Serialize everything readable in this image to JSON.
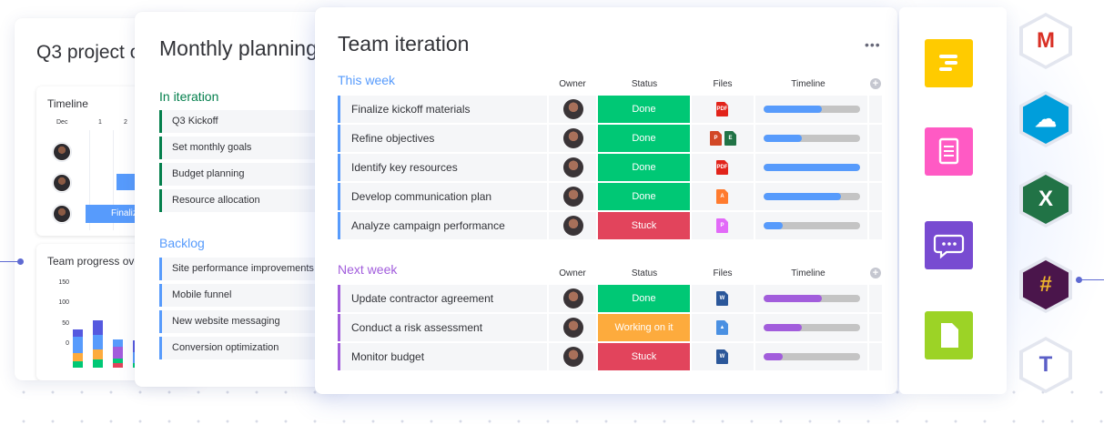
{
  "q3_card": {
    "title": "Q3 project o",
    "timeline": {
      "title": "Timeline",
      "headers": [
        "Dec",
        "1",
        "2"
      ],
      "bar_label": "Finaliz"
    },
    "progress": {
      "title": "Team progress ove",
      "y_ticks": [
        "150",
        "100",
        "50",
        "0"
      ],
      "stacks": [
        [
          {
            "v": 15,
            "c": "#00c875"
          },
          {
            "v": 20,
            "c": "#fdab3d"
          },
          {
            "v": 40,
            "c": "#579bfc"
          },
          {
            "v": 18,
            "c": "#5559df"
          }
        ],
        [
          {
            "v": 20,
            "c": "#00c875"
          },
          {
            "v": 25,
            "c": "#fdab3d"
          },
          {
            "v": 35,
            "c": "#579bfc"
          },
          {
            "v": 35,
            "c": "#5559df"
          }
        ],
        [
          {
            "v": 10,
            "c": "#e2445c"
          },
          {
            "v": 12,
            "c": "#00c875"
          },
          {
            "v": 28,
            "c": "#a25ddc"
          },
          {
            "v": 18,
            "c": "#579bfc"
          }
        ],
        [
          {
            "v": 12,
            "c": "#00c875"
          },
          {
            "v": 25,
            "c": "#579bfc"
          },
          {
            "v": 30,
            "c": "#5559df"
          }
        ]
      ]
    }
  },
  "monthly_card": {
    "title": "Monthly planning",
    "groups": [
      {
        "label": "In iteration",
        "color": "#037f4c",
        "items": [
          "Q3 Kickoff",
          "Set monthly goals",
          "Budget planning",
          "Resource allocation"
        ]
      },
      {
        "label": "Backlog",
        "color": "#579bfc",
        "items": [
          "Site performance improvements",
          "Mobile funnel",
          "New website messaging",
          "Conversion optimization"
        ]
      }
    ]
  },
  "team_card": {
    "title": "Team iteration",
    "more_label": "•••",
    "columns": {
      "owner": "Owner",
      "status": "Status",
      "files": "Files",
      "timeline": "Timeline",
      "add": "+"
    },
    "sections": [
      {
        "title": "This week",
        "color": "#579bfc",
        "rows": [
          {
            "name": "Finalize kickoff materials",
            "status": "Done",
            "status_color": "#00c875",
            "files": [
              {
                "t": "PDF",
                "c": "#e2231a"
              }
            ],
            "progress": 0.6
          },
          {
            "name": "Refine objectives",
            "status": "Done",
            "status_color": "#00c875",
            "files": [
              {
                "t": "P",
                "c": "#d24726"
              },
              {
                "t": "E",
                "c": "#217346"
              }
            ],
            "progress": 0.4
          },
          {
            "name": "Identify key resources",
            "status": "Done",
            "status_color": "#00c875",
            "files": [
              {
                "t": "PDF",
                "c": "#e2231a"
              }
            ],
            "progress": 1.0
          },
          {
            "name": "Develop communication plan",
            "status": "Done",
            "status_color": "#00c875",
            "files": [
              {
                "t": "A",
                "c": "#ff7b2e"
              }
            ],
            "progress": 0.8
          },
          {
            "name": "Analyze campaign performance",
            "status": "Stuck",
            "status_color": "#e2445c",
            "files": [
              {
                "t": "P",
                "c": "#e26af8"
              }
            ],
            "progress": 0.2
          }
        ]
      },
      {
        "title": "Next week",
        "color": "#a25ddc",
        "rows": [
          {
            "name": "Update contractor agreement",
            "status": "Done",
            "status_color": "#00c875",
            "files": [
              {
                "t": "W",
                "c": "#2b579a"
              }
            ],
            "progress": 0.6
          },
          {
            "name": "Conduct a risk assessment",
            "status": "Working on it",
            "status_color": "#fdab3d",
            "files": [
              {
                "t": "▲",
                "c": "#4a90e2"
              }
            ],
            "progress": 0.4
          },
          {
            "name": "Monitor budget",
            "status": "Stuck",
            "status_color": "#e2445c",
            "files": [
              {
                "t": "W",
                "c": "#2b579a"
              }
            ],
            "progress": 0.2
          }
        ]
      }
    ]
  },
  "app_tiles": [
    {
      "name": "notes-app-icon",
      "color": "#ffcb00"
    },
    {
      "name": "docs-app-icon",
      "color": "#ff5ac4"
    },
    {
      "name": "chat-app-icon",
      "color": "#784bd1"
    },
    {
      "name": "file-app-icon",
      "color": "#9cd326"
    }
  ],
  "integrations": [
    {
      "name": "gmail-icon",
      "bg": "#ffffff",
      "glyph": "M",
      "glyph_color": "#d93025"
    },
    {
      "name": "salesforce-icon",
      "bg": "#009edb",
      "glyph": "☁",
      "glyph_color": "#ffffff"
    },
    {
      "name": "excel-icon",
      "bg": "#217346",
      "glyph": "X",
      "glyph_color": "#ffffff"
    },
    {
      "name": "slack-icon",
      "bg": "#4a154b",
      "glyph": "#",
      "glyph_color": "#ecb22e"
    },
    {
      "name": "teams-icon",
      "bg": "#ffffff",
      "glyph": "T",
      "glyph_color": "#5b5fc7"
    }
  ]
}
